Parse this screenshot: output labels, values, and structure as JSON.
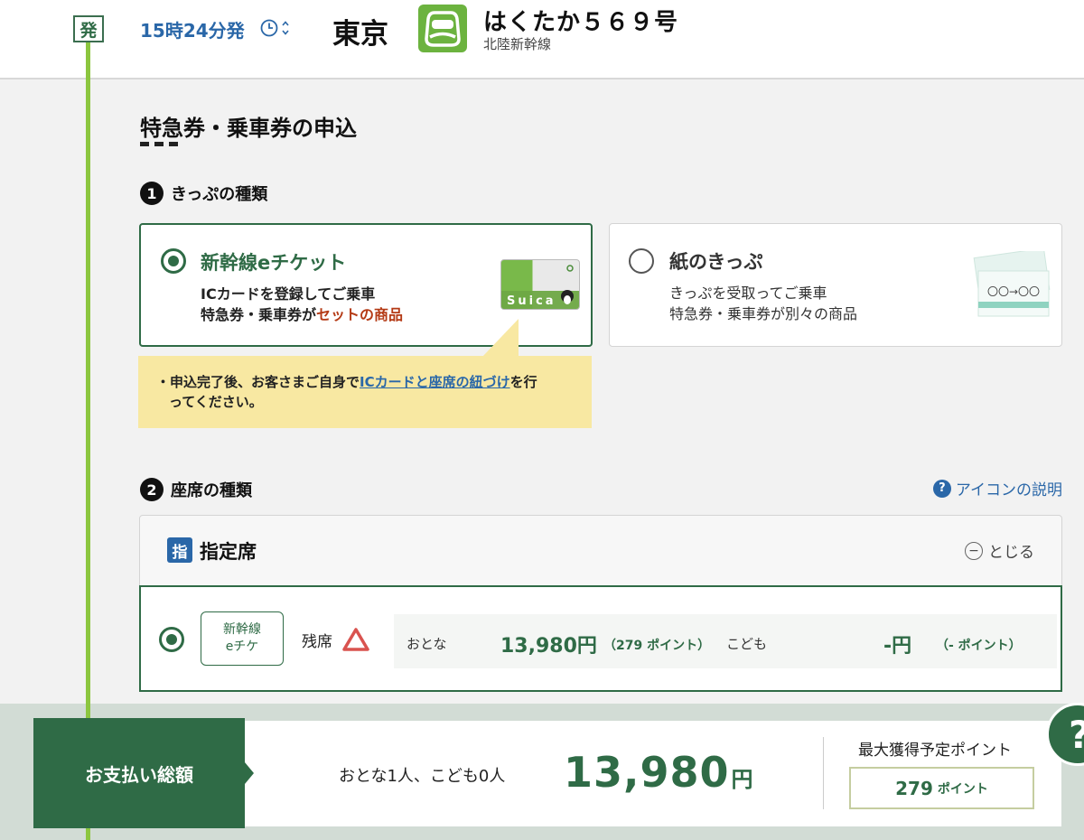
{
  "header": {
    "departure_badge": "発",
    "departure_time": "15時24分発",
    "station": "東京",
    "train_name": "はくたか５６９号",
    "train_line": "北陸新幹線"
  },
  "section": {
    "title": "特急券・乗車券の申込"
  },
  "ticket_type": {
    "step_number": "1",
    "heading": "きっぷの種類",
    "options": [
      {
        "title": "新幹線eチケット",
        "desc_line1": "ICカードを登録してご乗車",
        "desc_line2_prefix": "特急券・乗車券が",
        "desc_line2_accent": "セットの商品",
        "card_label": "Suica",
        "selected": true
      },
      {
        "title": "紙のきっぷ",
        "desc_line1": "きっぷを受取ってご乗車",
        "desc_line2": "特急券・乗車券が別々の商品",
        "ticket_label": "〇〇→〇〇",
        "selected": false
      }
    ],
    "note_prefix": "・申込完了後、お客さまご自身で",
    "note_link": "ICカードと座席の紐づけ",
    "note_suffix_line1": "を行",
    "note_line2": "ってください。"
  },
  "seat_type": {
    "step_number": "2",
    "heading": "座席の種類",
    "help_link": "アイコンの説明",
    "help_icon": "?",
    "category_badge": "指",
    "category_label": "指定席",
    "close_label": "とじる",
    "row": {
      "badge_line1": "新幹線",
      "badge_line2": "eチケ",
      "availability_label": "残席",
      "availability_icon": "triangle-limited",
      "adult_label": "おとな",
      "adult_price": "13,980円",
      "adult_points": "（279 ポイント）",
      "child_label": "こども",
      "child_price": "-円",
      "child_points": "（- ポイント）"
    }
  },
  "footer": {
    "pay_label": "お支払い総額",
    "passengers": "おとな1人、こども0人",
    "total_amount": "13,980",
    "total_unit": "円",
    "max_points_label": "最大獲得予定ポイント",
    "points_value": "279",
    "points_unit": "ポイント",
    "help_fab": "?"
  },
  "colors": {
    "brand_green": "#2f6b46",
    "timeline_green": "#8cc63f",
    "link_blue": "#2a67a8",
    "note_yellow": "#f8e8a2",
    "accent_red": "#b43a15"
  }
}
